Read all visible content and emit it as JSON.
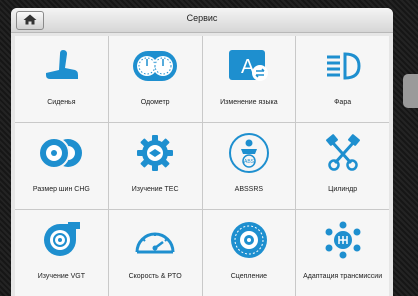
{
  "header": {
    "title": "Сервис",
    "home_icon": "home-icon"
  },
  "colors": {
    "accent": "#1e8fcf",
    "tile_bg": "#f6f6f6",
    "panel_bg": "#e6e6e6"
  },
  "tiles": [
    {
      "label": "Сиденья",
      "icon": "seat-icon"
    },
    {
      "label": "Одометр",
      "icon": "odometer-icon"
    },
    {
      "label": "Изменение языка",
      "icon": "language-icon"
    },
    {
      "label": "Фара",
      "icon": "headlight-icon"
    },
    {
      "label": "Размер шин CHG",
      "icon": "tire-size-icon"
    },
    {
      "label": "Изучение TEC",
      "icon": "tec-gear-icon"
    },
    {
      "label": "ABSSRS",
      "icon": "abs-srs-icon"
    },
    {
      "label": "Цилиндр",
      "icon": "cylinder-icon"
    },
    {
      "label": "Изучение VGT",
      "icon": "turbo-icon"
    },
    {
      "label": "Скорость & PTO",
      "icon": "speedometer-icon"
    },
    {
      "label": "Сцепление",
      "icon": "clutch-icon"
    },
    {
      "label": "Адаптация трансмиссии",
      "icon": "transmission-icon"
    }
  ]
}
